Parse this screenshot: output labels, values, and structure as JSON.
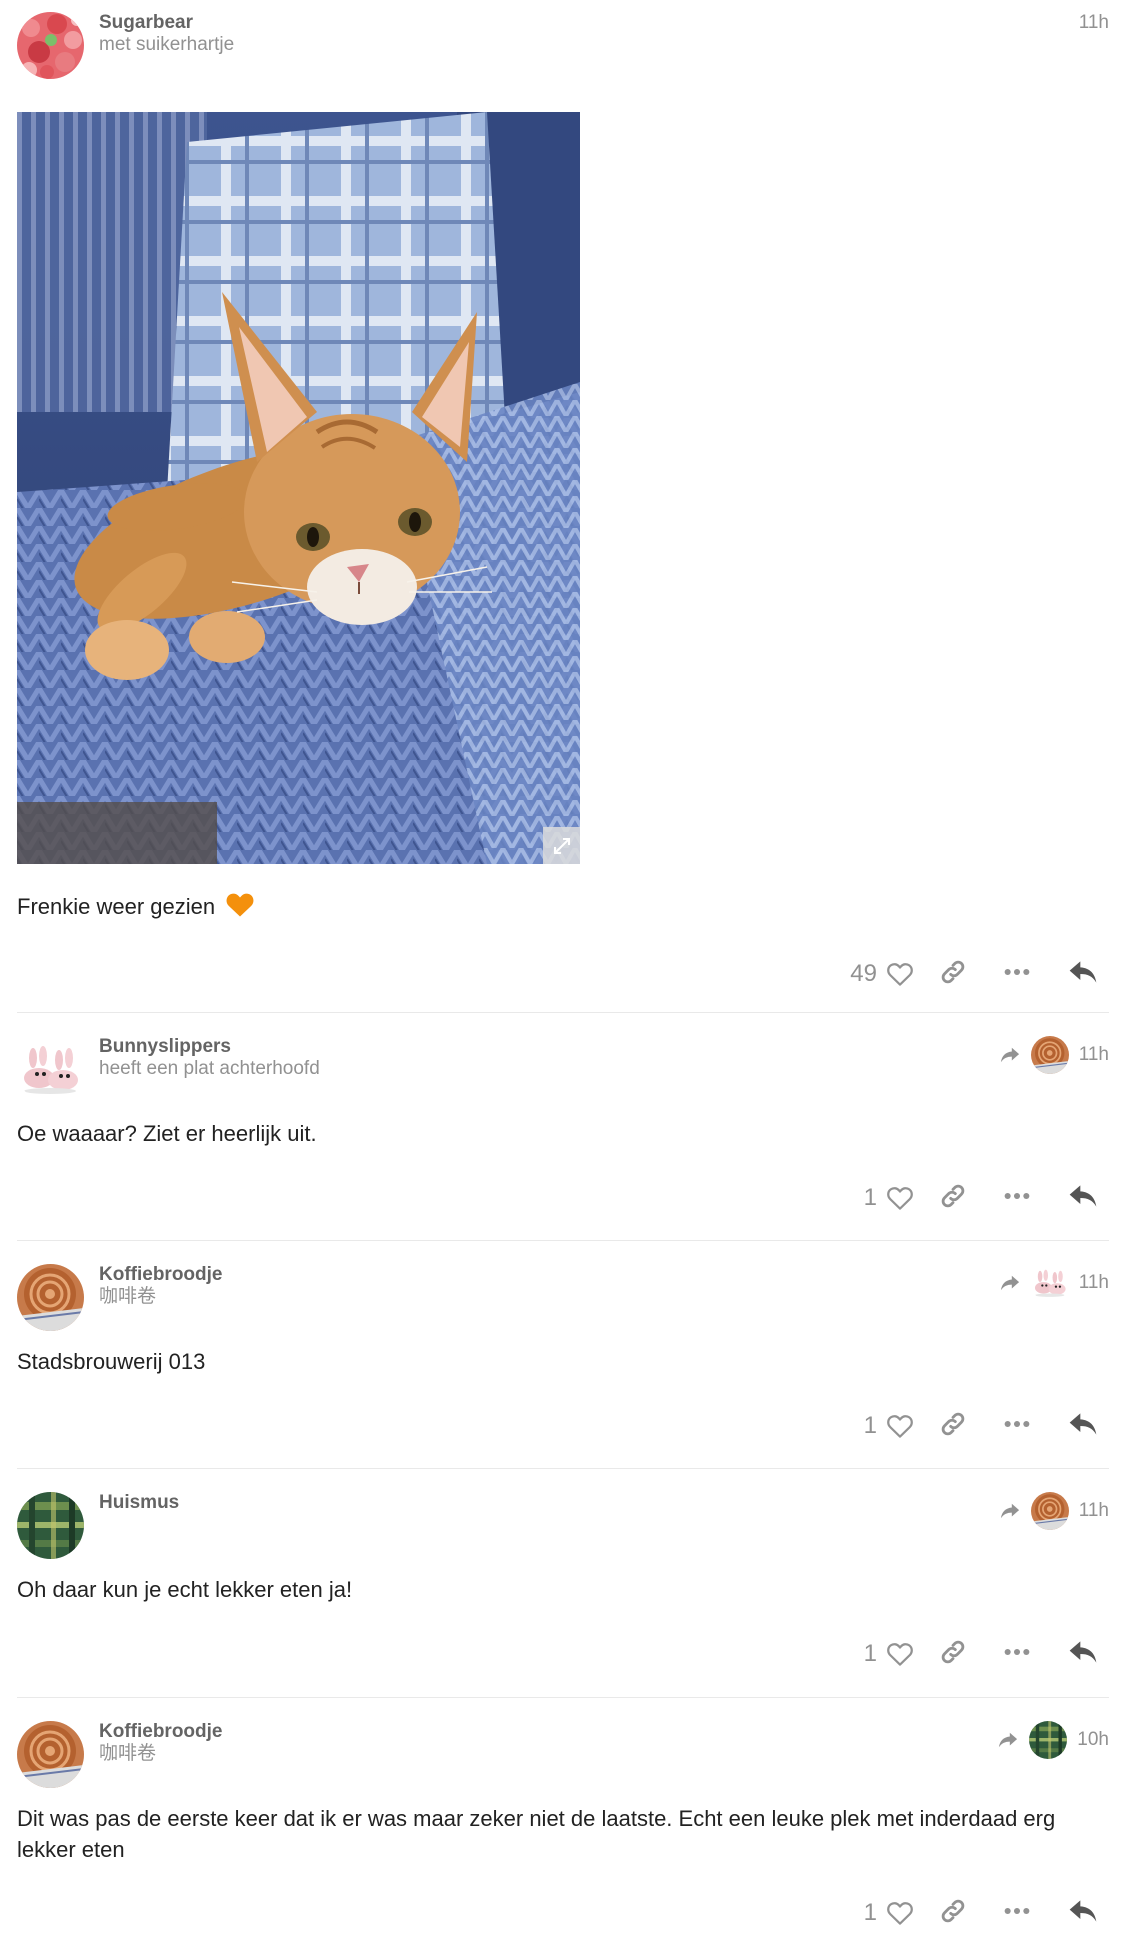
{
  "posts": [
    {
      "username": "Sugarbear",
      "user_title": "met suikerhartje",
      "time": "11h",
      "text": "Frenkie weer gezien",
      "emoji": "orange-heart",
      "likes": "49",
      "has_image": true,
      "image_subject": "ginger kitten on blue knitted blanket",
      "reply_to_avatar": null
    },
    {
      "username": "Bunnyslippers",
      "user_title": "heeft een plat achterhoofd",
      "time": "11h",
      "text": "Oe waaaar? Ziet er heerlijk uit.",
      "likes": "1",
      "reply_to_avatar": "cinnamon-roll-avatar"
    },
    {
      "username": "Koffiebroodje",
      "user_title": "咖啡卷",
      "time": "11h",
      "text": "Stadsbrouwerij 013",
      "likes": "1",
      "reply_to_avatar": "bunny-slippers-avatar"
    },
    {
      "username": "Huismus",
      "user_title": "",
      "time": "11h",
      "text": "Oh daar kun je echt lekker eten ja!",
      "likes": "1",
      "reply_to_avatar": "cinnamon-roll-avatar"
    },
    {
      "username": "Koffiebroodje",
      "user_title": "咖啡卷",
      "time": "10h",
      "text": "Dit was pas de eerste keer dat ik er was maar zeker niet de laatste. Echt een leuke plek met inderdaad erg lekker eten",
      "likes": "1",
      "reply_to_avatar": "green-plaid-avatar"
    }
  ],
  "icons": {
    "like": "heart-icon",
    "link": "link-icon",
    "more": "ellipsis-icon",
    "reply": "reply-icon",
    "expand": "expand-icon",
    "reply_to": "share-arrow-icon"
  },
  "colors": {
    "muted_text": "#919191",
    "username": "#646464",
    "icon": "#929292",
    "reply_icon": "#555555",
    "divider": "#e9e9e9",
    "emoji_heart": "#f4900c"
  }
}
